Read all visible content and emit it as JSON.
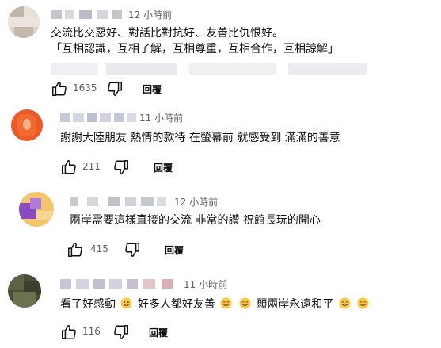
{
  "comments": [
    {
      "time": "12 小時前",
      "lines": [
        "交流比交惡好、對話比對抗好、友善比仇恨好。",
        "「互相認識，互相了解，互相尊重，互相合作，互相諒解」"
      ],
      "likes": "1635",
      "reply_label": "回覆"
    },
    {
      "time": "11 小時前",
      "text": "謝謝大陸朋友 熱情的款待 在螢幕前 就感受到 滿滿的善意",
      "likes": "211",
      "reply_label": "回覆"
    },
    {
      "time": "12 小時前",
      "text": "兩岸需要這樣直接的交流 非常的讚 祝館長玩的開心",
      "likes": "415",
      "reply_label": "回覆"
    },
    {
      "time": "11 小時前",
      "text_parts": [
        "看了好感動",
        "好多人都好友善",
        "願兩岸永遠和平"
      ],
      "likes": "116",
      "reply_label": "回覆"
    }
  ],
  "icons": {
    "like": "thumbs-up-icon",
    "dislike": "thumbs-down-icon",
    "emoji": "smiling-face-emoji"
  }
}
